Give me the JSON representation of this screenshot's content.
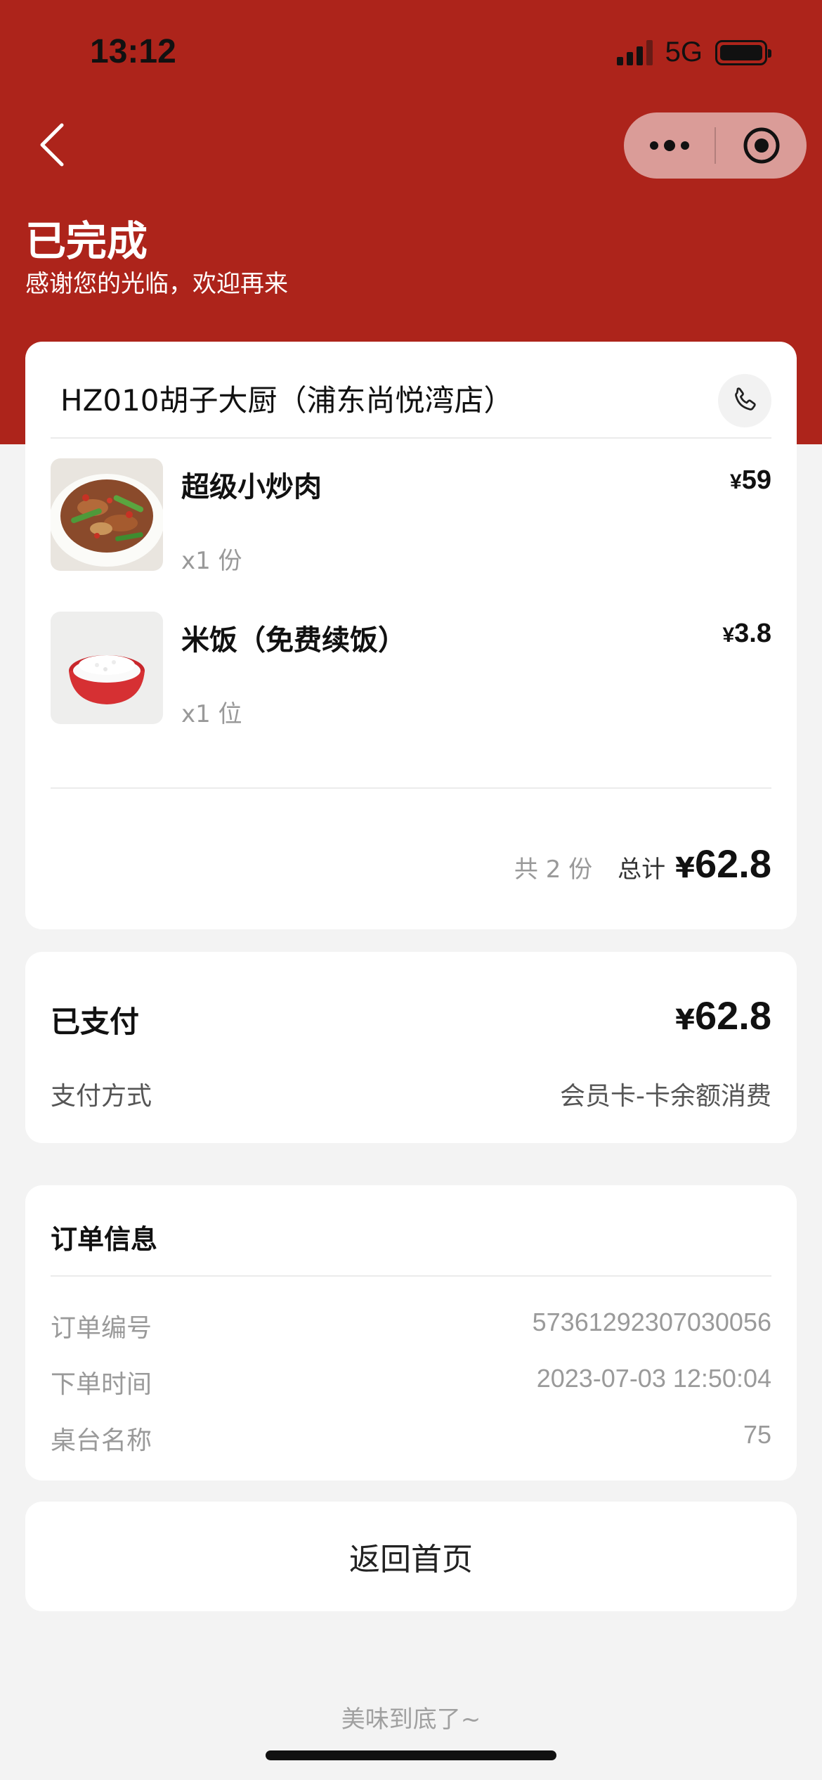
{
  "status_bar": {
    "time": "13:12",
    "network": "5G"
  },
  "header": {
    "title": "已完成",
    "subtitle": "感谢您的光临，欢迎再来",
    "color": "#ad241b"
  },
  "order": {
    "store_name": "HZ010胡子大厨（浦东尚悦湾店）",
    "items": [
      {
        "name": "超级小炒肉",
        "qty": "x1 份",
        "currency": "¥",
        "price": "59",
        "image": "stir-fried-pork-photo"
      },
      {
        "name": "米饭（免费续饭）",
        "qty": "x1 位",
        "currency": "¥",
        "price": "3.8",
        "image": "rice-bowl-photo"
      }
    ],
    "count_text": "共 2 份",
    "total_label": "总计",
    "total_currency": "¥",
    "total_amount": "62.8"
  },
  "payment": {
    "paid_label": "已支付",
    "currency": "¥",
    "paid_amount": "62.8",
    "method_label": "支付方式",
    "method_value": "会员卡-卡余额消费"
  },
  "info": {
    "title": "订单信息",
    "rows": [
      {
        "label": "订单编号",
        "value": "57361292307030056"
      },
      {
        "label": "下单时间",
        "value": "2023-07-03 12:50:04"
      },
      {
        "label": "桌台名称",
        "value": "75"
      }
    ]
  },
  "home_button": "返回首页",
  "footer": "美味到底了~"
}
